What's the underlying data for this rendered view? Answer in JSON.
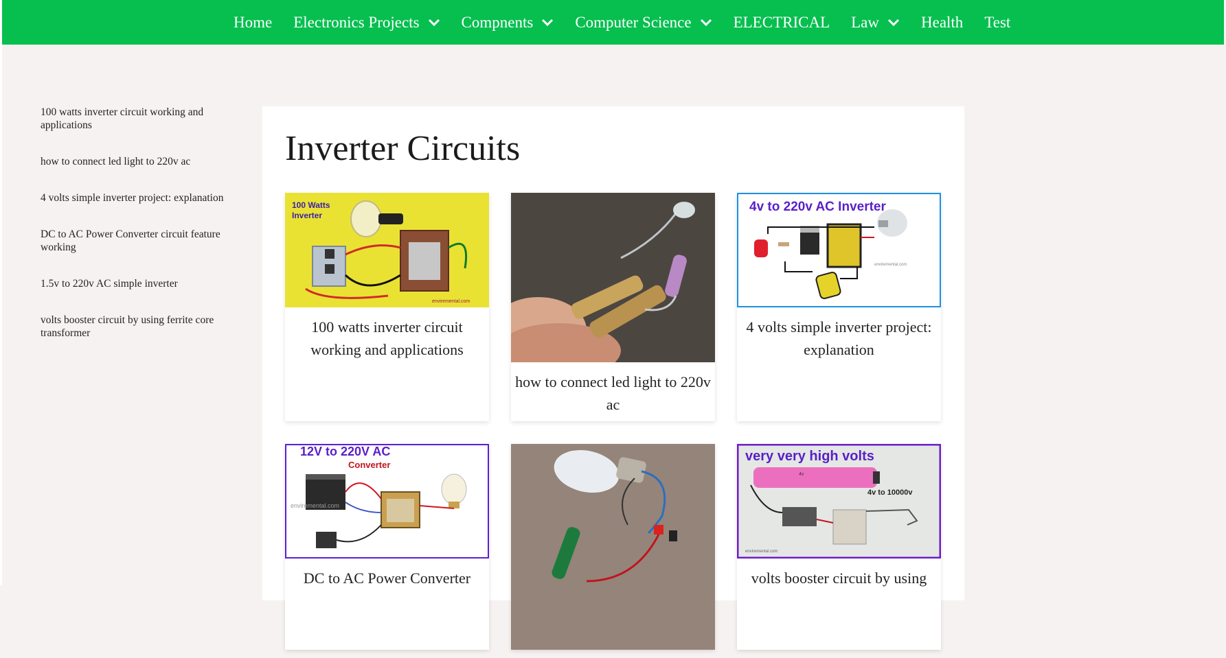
{
  "nav": {
    "items": [
      {
        "label": "Home",
        "has_dropdown": false
      },
      {
        "label": "Electronics Projects",
        "has_dropdown": true
      },
      {
        "label": "Compnents",
        "has_dropdown": true
      },
      {
        "label": "Computer Science",
        "has_dropdown": true
      },
      {
        "label": "ELECTRICAL",
        "has_dropdown": false
      },
      {
        "label": "Law",
        "has_dropdown": true
      },
      {
        "label": "Health",
        "has_dropdown": false
      },
      {
        "label": "Test",
        "has_dropdown": false
      }
    ]
  },
  "sidebar": {
    "links": [
      "100 watts inverter circuit working and applications",
      "how to connect led light to 220v ac",
      "4 volts simple inverter project: explanation",
      "DC to AC Power Converter circuit feature working",
      "1.5v to 220v AC simple inverter",
      "volts booster circuit by using ferrite core transformer"
    ]
  },
  "main": {
    "title": "Inverter Circuits",
    "cards": [
      {
        "caption": "100 watts inverter circuit working and applications",
        "image_text": [
          "100 Watts",
          "Inverter"
        ],
        "watermark": "enviremental.com"
      },
      {
        "caption": "how to connect led light to 220v ac"
      },
      {
        "caption": "4 volts simple inverter project: explanation",
        "image_text": [
          "4v to 220v AC Inverter"
        ],
        "watermark": "enviremental.com"
      },
      {
        "caption": "DC to AC Power Converter",
        "image_text": [
          "12V to 220V AC",
          "Converter"
        ],
        "watermark": "enviremental.com"
      },
      {
        "caption": ""
      },
      {
        "caption": "volts booster circuit by using",
        "image_text": [
          "very very high volts",
          "4v",
          "4v to 10000v"
        ],
        "watermark": "enviremental.com"
      }
    ]
  },
  "colors": {
    "nav_bg": "#06bf4f",
    "page_bg": "#f7f2f2",
    "panel_bg": "#ffffff",
    "card3_border": "#1e90e0",
    "card4_border": "#5b1fd4",
    "card6_border": "#6d1ec9"
  }
}
